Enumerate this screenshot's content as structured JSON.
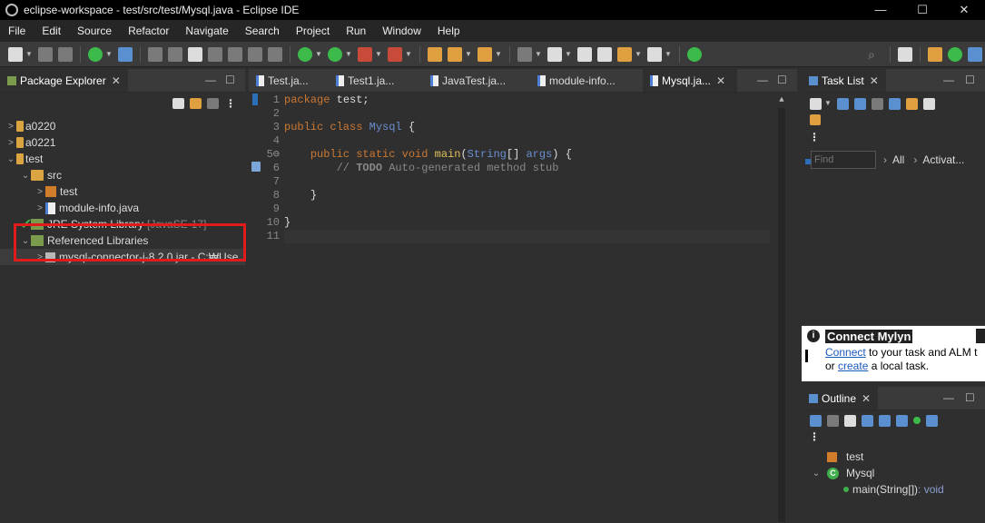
{
  "window": {
    "title": "eclipse-workspace - test/src/test/Mysql.java - Eclipse IDE",
    "controls": [
      "—",
      "☐",
      "✕"
    ]
  },
  "menu": [
    "File",
    "Edit",
    "Source",
    "Refactor",
    "Navigate",
    "Search",
    "Project",
    "Run",
    "Window",
    "Help"
  ],
  "package_explorer": {
    "tab_label": "Package Explorer",
    "tree": [
      {
        "label": "a0220",
        "indent": 0,
        "chevron": ">",
        "icon": "project"
      },
      {
        "label": "a0221",
        "indent": 0,
        "chevron": ">",
        "icon": "project"
      },
      {
        "label": "test",
        "indent": 0,
        "chevron": "v",
        "icon": "project"
      },
      {
        "label": "src",
        "indent": 1,
        "chevron": "v",
        "icon": "folder"
      },
      {
        "label": "test",
        "indent": 2,
        "chevron": ">",
        "icon": "package"
      },
      {
        "label": "module-info.java",
        "indent": 2,
        "chevron": ">",
        "icon": "java"
      },
      {
        "label": "JRE System Library",
        "suffix": "[JavaSE-17]",
        "indent": 1,
        "chevron": ">",
        "icon": "library"
      },
      {
        "label": "Referenced Libraries",
        "indent": 1,
        "chevron": "v",
        "icon": "library"
      },
      {
        "label": "mysql-connector-j-8.2.0.jar - C:₩Use",
        "indent": 2,
        "chevron": ">",
        "icon": "jar"
      }
    ]
  },
  "editor": {
    "tabs": [
      {
        "label": "Test.ja...",
        "active": false
      },
      {
        "label": "Test1.ja...",
        "active": false
      },
      {
        "label": "JavaTest.ja...",
        "active": false
      },
      {
        "label": "module-info...",
        "active": false
      },
      {
        "label": "Mysql.ja...",
        "active": true
      }
    ],
    "line_numbers": [
      "1",
      "2",
      "3",
      "4",
      "5",
      "6",
      "7",
      "8",
      "9",
      "10",
      "11"
    ],
    "code": {
      "l1_kw": "package",
      "l1_rest": " test;",
      "l3_kw": "public class",
      "l3_cls": "Mysql",
      "l3_rest": " {",
      "l5_kw": "public static void",
      "l5_fn": "main",
      "l5_p1": "(",
      "l5_type": "String",
      "l5_p2": "[] ",
      "l5_arg": "args",
      "l5_p3": ") {",
      "l6_cm": "// ",
      "l6_todo": "TODO",
      "l6_rest": " Auto-generated method stub",
      "l8": "}",
      "l10": "}"
    }
  },
  "task_list": {
    "tab_label": "Task List",
    "find_placeholder": "Find",
    "filter_all": "All",
    "filter_activate": "Activat..."
  },
  "mylyn": {
    "title": "Connect Mylyn",
    "connect_link": "Connect",
    "line1_rest": " to your task and ALM t",
    "line2_pre": "or ",
    "create_link": "create",
    "line2_rest": " a local task."
  },
  "outline": {
    "tab_label": "Outline",
    "items": [
      {
        "label": "test",
        "icon": "package"
      },
      {
        "label": "Mysql",
        "icon": "class"
      },
      {
        "label": "main(String[])",
        "type": " : void",
        "icon": "method"
      }
    ]
  }
}
